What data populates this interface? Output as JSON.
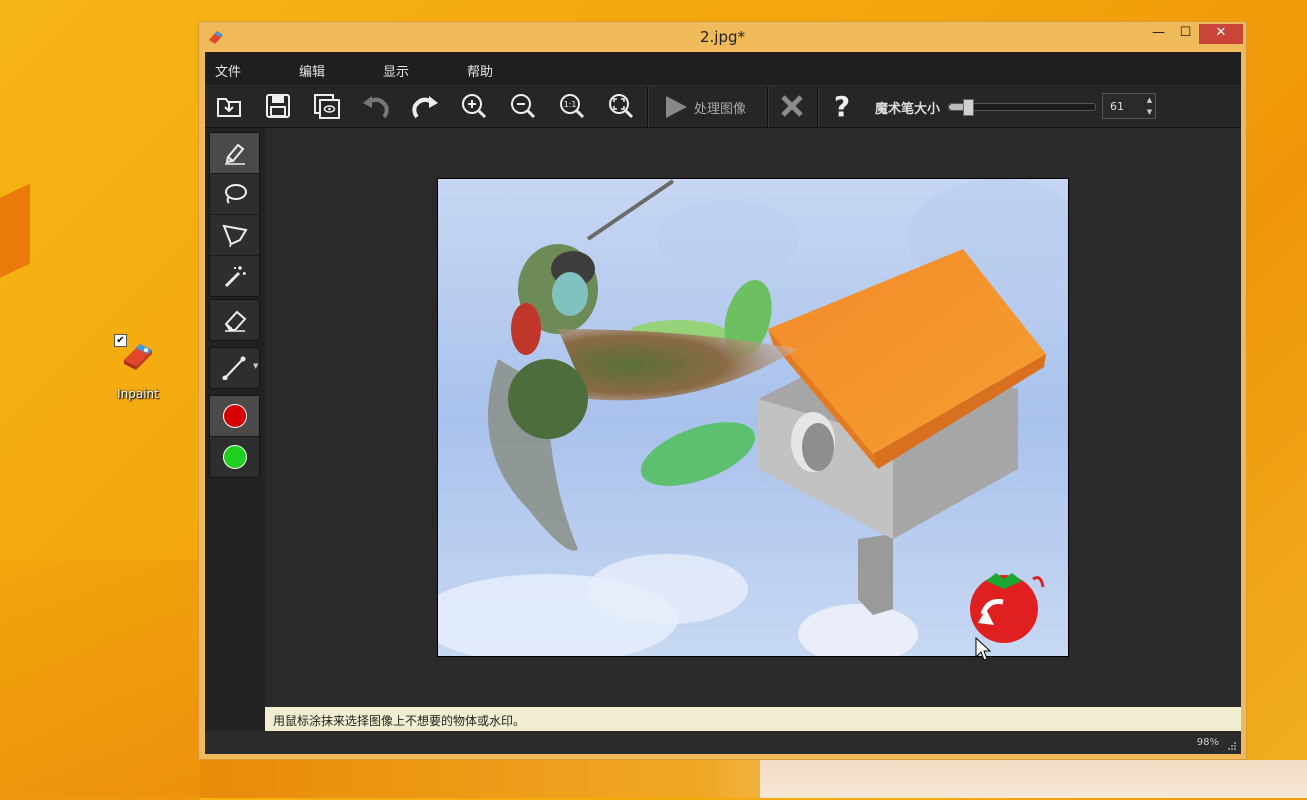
{
  "desktop": {
    "icon_label": "Inpaint"
  },
  "window": {
    "title": "2.jpg*",
    "controls": {
      "minimize": "—",
      "maximize": "☐",
      "close": "✕"
    }
  },
  "menu": [
    "文件",
    "编辑",
    "显示",
    "帮助"
  ],
  "toolbar": {
    "process_label": "处理图像",
    "brush_size_label": "魔术笔大小",
    "brush_size_value": "61",
    "brush_size_fraction": 0.12
  },
  "colors": {
    "red_marker": "#d40000",
    "green_marker": "#1fcf1f",
    "hint_bg": "#f0edd1"
  },
  "hint_text": "用鼠标涂抹来选择图像上不想要的物体或水印。",
  "status": {
    "zoom": "98%"
  }
}
